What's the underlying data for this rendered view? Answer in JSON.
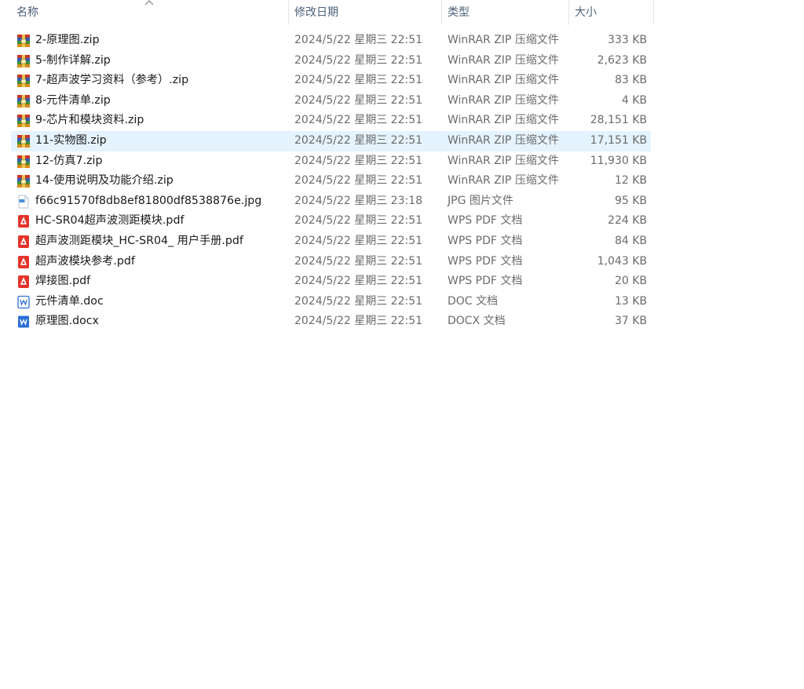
{
  "columns": {
    "name": "名称",
    "date": "修改日期",
    "type": "类型",
    "size": "大小"
  },
  "files": [
    {
      "name": "2-原理图.zip",
      "date": "2024/5/22 星期三 22:51",
      "type": "WinRAR ZIP 压缩文件",
      "size": "333 KB",
      "icon": "winrar-zip-icon"
    },
    {
      "name": "5-制作详解.zip",
      "date": "2024/5/22 星期三 22:51",
      "type": "WinRAR ZIP 压缩文件",
      "size": "2,623 KB",
      "icon": "winrar-zip-icon"
    },
    {
      "name": "7-超声波学习资料（参考）.zip",
      "date": "2024/5/22 星期三 22:51",
      "type": "WinRAR ZIP 压缩文件",
      "size": "83 KB",
      "icon": "winrar-zip-icon"
    },
    {
      "name": "8-元件清单.zip",
      "date": "2024/5/22 星期三 22:51",
      "type": "WinRAR ZIP 压缩文件",
      "size": "4 KB",
      "icon": "winrar-zip-icon"
    },
    {
      "name": "9-芯片和模块资料.zip",
      "date": "2024/5/22 星期三 22:51",
      "type": "WinRAR ZIP 压缩文件",
      "size": "28,151 KB",
      "icon": "winrar-zip-icon"
    },
    {
      "name": "11-实物图.zip",
      "date": "2024/5/22 星期三 22:51",
      "type": "WinRAR ZIP 压缩文件",
      "size": "17,151 KB",
      "icon": "winrar-zip-icon",
      "selected": true
    },
    {
      "name": "12-仿真7.zip",
      "date": "2024/5/22 星期三 22:51",
      "type": "WinRAR ZIP 压缩文件",
      "size": "11,930 KB",
      "icon": "winrar-zip-icon"
    },
    {
      "name": "14-使用说明及功能介绍.zip",
      "date": "2024/5/22 星期三 22:51",
      "type": "WinRAR ZIP 压缩文件",
      "size": "12 KB",
      "icon": "winrar-zip-icon"
    },
    {
      "name": "f66c91570f8db8ef81800df8538876e.jpg",
      "date": "2024/5/22 星期三 23:18",
      "type": "JPG 图片文件",
      "size": "95 KB",
      "icon": "image-file-icon"
    },
    {
      "name": "HC-SR04超声波测距模块.pdf",
      "date": "2024/5/22 星期三 22:51",
      "type": "WPS PDF 文档",
      "size": "224 KB",
      "icon": "pdf-file-icon"
    },
    {
      "name": "超声波测距模块_HC-SR04_ 用户手册.pdf",
      "date": "2024/5/22 星期三 22:51",
      "type": "WPS PDF 文档",
      "size": "84 KB",
      "icon": "pdf-file-icon"
    },
    {
      "name": "超声波模块参考.pdf",
      "date": "2024/5/22 星期三 22:51",
      "type": "WPS PDF 文档",
      "size": "1,043 KB",
      "icon": "pdf-file-icon"
    },
    {
      "name": "焊接图.pdf",
      "date": "2024/5/22 星期三 22:51",
      "type": "WPS PDF 文档",
      "size": "20 KB",
      "icon": "pdf-file-icon"
    },
    {
      "name": "元件清单.doc",
      "date": "2024/5/22 星期三 22:51",
      "type": "DOC 文档",
      "size": "13 KB",
      "icon": "doc-file-icon"
    },
    {
      "name": "原理图.docx",
      "date": "2024/5/22 星期三 22:51",
      "type": "DOCX 文档",
      "size": "37 KB",
      "icon": "docx-file-icon"
    }
  ],
  "colors": {
    "selection": "#e5f3ff",
    "header_text": "#4c607a",
    "pdf_red": "#e5332a",
    "doc_blue": "#2b6fd6"
  }
}
